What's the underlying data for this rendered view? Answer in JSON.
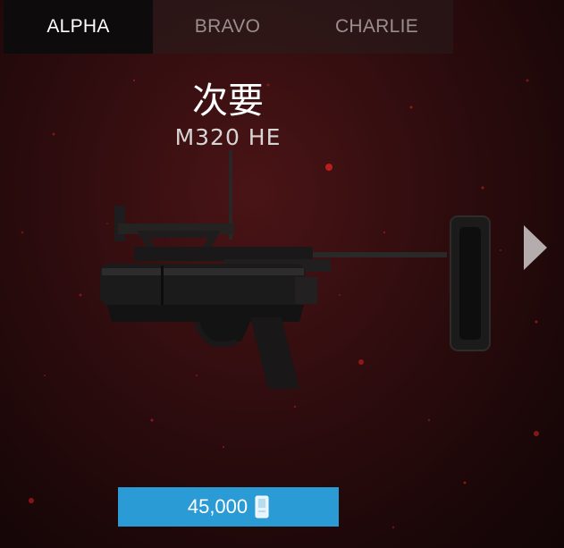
{
  "tabs": [
    {
      "label": "ALPHA",
      "active": true
    },
    {
      "label": "BRAVO",
      "active": false
    },
    {
      "label": "CHARLIE",
      "active": false
    }
  ],
  "slot_title": "次要",
  "weapon_name": "M320 HE",
  "purchase": {
    "price": "45,000",
    "currency_icon": "currency-card-icon"
  },
  "icons": {
    "next": "chevron-right-icon"
  },
  "colors": {
    "accent": "#2a9bd4",
    "background": "#2e0c0e",
    "tab_active": "#0d0b0b"
  }
}
